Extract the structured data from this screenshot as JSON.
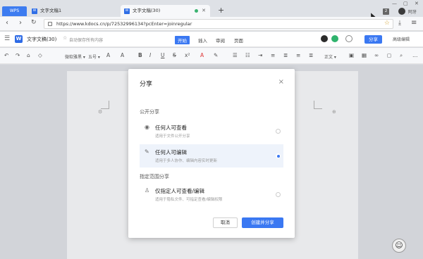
{
  "browser": {
    "wps_tab": "WPS",
    "tabs": [
      {
        "favicon": "W",
        "title": "文字文稿1"
      },
      {
        "favicon": "W",
        "title": "文字文稿(30)"
      }
    ],
    "new_tab": "+",
    "tab_count": "2",
    "user_name": "阿牙",
    "window_controls": [
      "—",
      "▢",
      "✕"
    ],
    "nav": {
      "back": "‹",
      "forward": "›",
      "reload": "↻"
    },
    "url": "https://www.kdocs.cn/p/72532996134?pcEnter=joinregular"
  },
  "app": {
    "logo": "W",
    "doc_title": "文字文稿(30)",
    "save_status": "自动保存所有内容",
    "tabs": [
      "开始",
      "插入",
      "审阅",
      "页面"
    ],
    "active_tab": "开始",
    "share_button": "分享",
    "advanced_edit": "高级编辑"
  },
  "toolbar": {
    "font_name": "微软雅黑 ▾",
    "font_size": "五号 ▾",
    "paragraph_style": "正文 ▾",
    "buttons": [
      "B",
      "I",
      "U",
      "S",
      "A",
      "✎",
      "≡",
      "≣"
    ]
  },
  "share_dialog": {
    "title": "分享",
    "close": "×",
    "public_section": "公开分享",
    "options": [
      {
        "title": "任何人可查看",
        "desc": "适用于文件公开分享",
        "selected": false,
        "icon": "eye-icon"
      },
      {
        "title": "任何人可编辑",
        "desc": "适用于多人协作、编辑内容实时更新",
        "selected": true,
        "icon": "pencil-icon"
      }
    ],
    "scoped_section": "指定范围分享",
    "scoped_option": {
      "title": "仅指定人可查看/编辑",
      "desc": "适用于隐私文件、可指定查看/编辑权限",
      "selected": false,
      "icon": "person-icon"
    },
    "cancel": "取消",
    "create": "创建并分享"
  },
  "colors": {
    "accent": "#3a78f2",
    "wps_brand": "#3d7cf0"
  }
}
